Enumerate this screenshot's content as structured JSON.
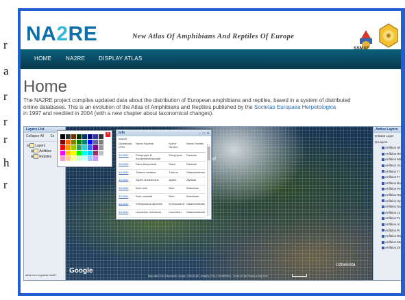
{
  "side_text": [
    "r",
    "a",
    "r",
    "r",
    "r",
    "h",
    "r"
  ],
  "header": {
    "logo_prefix": "NA",
    "logo_digit": "2",
    "logo_suffix": "RE",
    "tagline": "New Atlas Of Amphibians And Reptiles Of Europe",
    "ssm_caption": "SSMAF"
  },
  "nav": {
    "items": [
      "HOME",
      "NA2RE",
      "DISPLAY ATLAS"
    ]
  },
  "page": {
    "title": "Home",
    "intro_line1": "The NA2RE project compiles updated data about the distribution of European amphibians and reptiles, based in a system of distributed",
    "intro_line2_pre": "online databases. This is an evolution of the Atlas of Amphibians and Reptiles published by the ",
    "intro_link": "Societas Europaea Herpetologica",
    "intro_line3": "in 1997 and reedited in 2004 (with a new chapter about taxonomical changes)."
  },
  "left_panel": {
    "title": "Layers List",
    "toolbar": "Collapse All",
    "toolbar2": "Ex",
    "items": [
      "Layers",
      "Anfibios",
      "Reptiles"
    ],
    "status": "atlas.iucn.org/atlas.htmlf?"
  },
  "right_panel": {
    "title": "Active Layers",
    "base_layer": "Base Layer",
    "layers": "Layers",
    "items": [
      "Anfibios Sk",
      "Anfibios Re",
      "Anfibios Ma",
      "Anfibios Vo",
      "Anfibios Tr",
      "Anfibios Tr",
      "Anfibios Bu",
      "Anfibios Pe",
      "Anfibios Ra",
      "Anfibios Hy",
      "Anfibios Sa",
      "Anfibios Lo",
      "Anfibios Tu",
      "Anfibios Al",
      "Anfibios Pr",
      "Anfibios Ra",
      "Anfibios Mo",
      "Anfibios Ze"
    ]
  },
  "info_window": {
    "title": "Info",
    "controls": "- □ ×",
    "subtitle": "mas45",
    "columns": [
      "Quadricula UTM",
      "Nome Especie",
      "Nome Genero",
      "Nome Familia"
    ],
    "rows": [
      [
        "32L8/52",
        "Pelophylax kl. esculentus/lessonae",
        "Pelophylax",
        "Ranidae"
      ],
      [
        "32L8/52",
        "Rana temporaria",
        "Rana",
        "Ranidae"
      ],
      [
        "32L8/52",
        "Triturus cristatus",
        "Triturus",
        "Salamandridae"
      ],
      [
        "32L8/52",
        "Alytes obstetricans",
        "Alytes",
        "Alytidae"
      ],
      [
        "32L8/52",
        "Bufo bufo",
        "Bufo",
        "Bufonidae"
      ],
      [
        "32L8/52",
        "Bufo calamita",
        "Bufo",
        "Bufonidae"
      ],
      [
        "32L8/52",
        "Ichthyosaura alpestris",
        "Ichthyosaura",
        "Salamandridae"
      ],
      [
        "32L8/52",
        "Lissotriton helveticus",
        "Lissotriton",
        "Salamandridae"
      ],
      [
        "32L8/52",
        "Lissotriton vulgaris",
        "Lissotriton",
        "Salamandridae"
      ],
      [
        "32L8/52",
        "Ichthyosaura alpestris",
        "Ichthyosaura",
        "Salamandridae"
      ]
    ]
  },
  "map": {
    "labels": [
      "Finland",
      "Uzbekista"
    ],
    "google": "Google",
    "attribution": "Map data ©2013 Basarsoft, Google, ORION-ME, Imagery ©2013 TerraMetrics - Terms of Use  Report a map error"
  },
  "palette_colors": [
    "#000000",
    "#333333",
    "#663300",
    "#003300",
    "#003366",
    "#000080",
    "#333399",
    "#333333",
    "#800000",
    "#ff6600",
    "#808000",
    "#008000",
    "#008080",
    "#0000ff",
    "#666699",
    "#808080",
    "#ff0000",
    "#ff9900",
    "#99cc00",
    "#339966",
    "#33cccc",
    "#3366ff",
    "#800080",
    "#999999",
    "#ff00ff",
    "#ffcc00",
    "#ffff00",
    "#00ff00",
    "#00ffff",
    "#00ccff",
    "#993366",
    "#c0c0c0",
    "#ff99cc",
    "#ffcc99",
    "#ffff99",
    "#ccffcc",
    "#ccffff",
    "#99ccff",
    "#cc99ff",
    "#ffffff"
  ],
  "colors": {
    "frame": "#1f5fd0",
    "nav_top": "#0c5f7c",
    "nav_bottom": "#06384c",
    "logo": "#0f6fa8",
    "link": "#2a6fb1"
  }
}
